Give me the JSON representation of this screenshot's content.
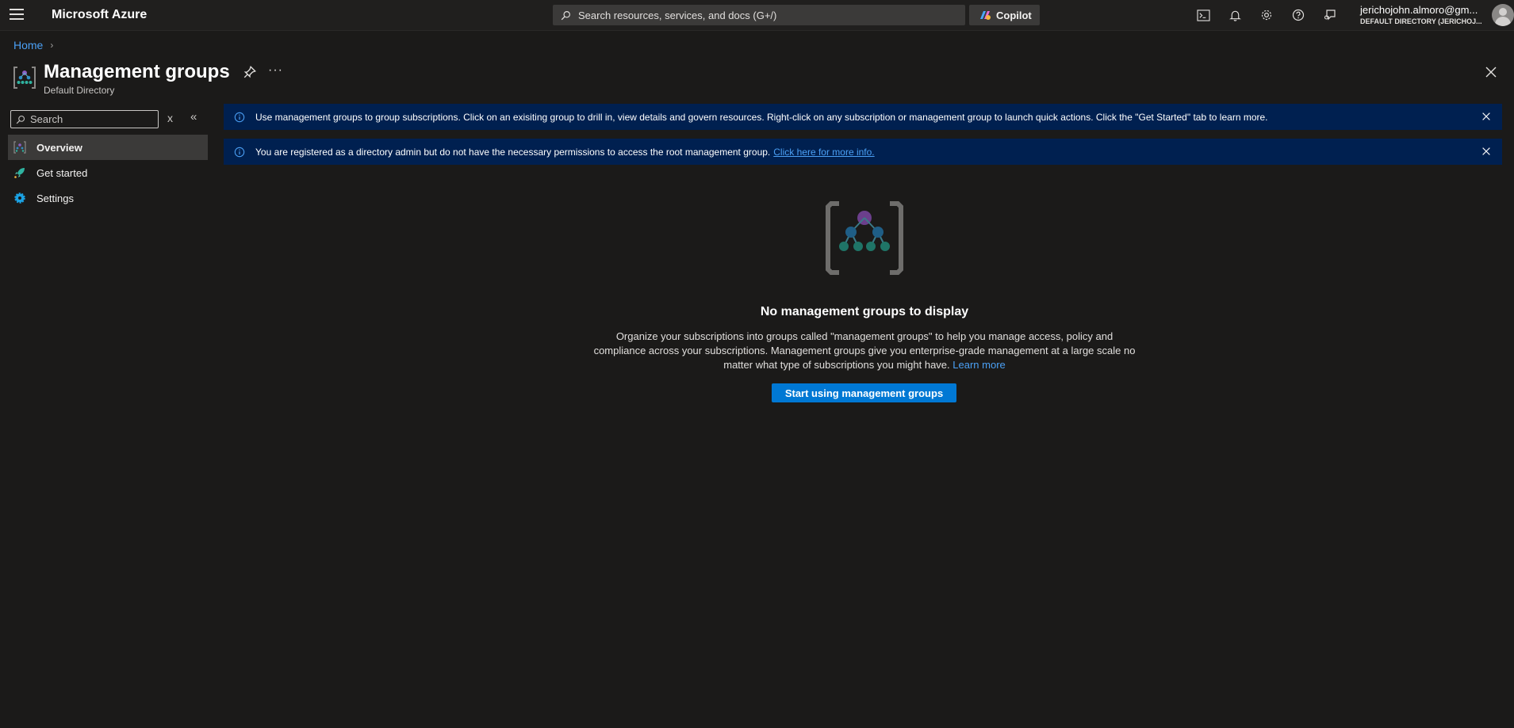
{
  "topbar": {
    "brand": "Microsoft Azure",
    "search_placeholder": "Search resources, services, and docs (G+/)",
    "copilot_label": "Copilot",
    "account_email": "jerichojohn.almoro@gm...",
    "account_directory": "DEFAULT DIRECTORY (JERICHOJ..."
  },
  "breadcrumb": {
    "home": "Home",
    "separator": ">"
  },
  "header": {
    "title": "Management groups",
    "subtitle": "Default Directory",
    "more": "···"
  },
  "menu": {
    "search_placeholder": "Search",
    "clear": "x",
    "collapse": "«",
    "items": [
      {
        "label": "Overview",
        "icon": "management-groups-icon",
        "active": true
      },
      {
        "label": "Get started",
        "icon": "rocket-icon",
        "active": false
      },
      {
        "label": "Settings",
        "icon": "gear-icon",
        "active": false
      }
    ]
  },
  "banners": [
    {
      "text": "Use management groups to group subscriptions. Click on an exisiting group to drill in, view details and govern resources. Right-click on any subscription or management group to launch quick actions. Click the \"Get Started\" tab to learn more."
    },
    {
      "text": "You are registered as a directory admin but do not have the necessary permissions to access the root management group.",
      "link": "Click here for more info."
    }
  ],
  "empty_state": {
    "title": "No management groups to display",
    "description": "Organize your subscriptions into groups called \"management groups\" to help you manage access, policy and compliance across your subscriptions. Management groups give you enterprise-grade management at a large scale no matter what type of subscriptions you might have.",
    "learn_more": "Learn more",
    "button": "Start using management groups"
  },
  "colors": {
    "accent": "#0078d4",
    "banner_bg": "#002050",
    "link": "#4ba0f5",
    "background": "#1b1a19"
  }
}
